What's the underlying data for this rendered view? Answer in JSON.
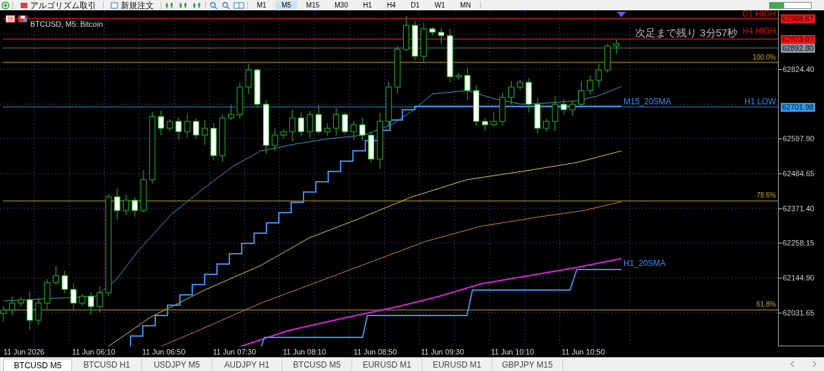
{
  "toolbar": {
    "buttons": [
      {
        "label": "アルゴリズム取引",
        "kind": "algo"
      },
      {
        "label": "新規注文",
        "kind": "order"
      }
    ],
    "timeframes": [
      {
        "label": "M1",
        "selected": false
      },
      {
        "label": "M5",
        "selected": true
      },
      {
        "label": "M15",
        "selected": false
      },
      {
        "label": "M30",
        "selected": false
      },
      {
        "label": "H1",
        "selected": false
      },
      {
        "label": "H4",
        "selected": false
      },
      {
        "label": "D1",
        "selected": false
      },
      {
        "label": "W1",
        "selected": false
      },
      {
        "label": "MN",
        "selected": false
      }
    ]
  },
  "chart": {
    "title": "BTCUSD, M5: Bitcoin",
    "countdown": "次足まで残り 3分57秒",
    "levels": [
      {
        "kind": "high",
        "label": "D1 HIGH",
        "tag": "62988.67"
      },
      {
        "kind": "high",
        "label": "H4 HIGH",
        "tag": "62923.07"
      },
      {
        "kind": "bid",
        "tag": "62892.80"
      },
      {
        "kind": "fib",
        "label": "100.0%"
      },
      {
        "kind": "low",
        "label": "H1 LOW",
        "tag": "62701.98"
      },
      {
        "kind": "fib",
        "label": "78.6%"
      },
      {
        "kind": "fib",
        "label": "61.8%"
      }
    ],
    "line_labels": [
      "M15_20SMA",
      "H1_20SMA"
    ],
    "price_axis": [
      "62824.40",
      "62597.90",
      "62484.65",
      "62371.40",
      "62258.15",
      "62144.90",
      "62031.65"
    ],
    "time_axis": [
      "11 Jun 2026",
      "11 Jun 06:10",
      "11 Jun 06:50",
      "11 Jun 07:30",
      "11 Jun 08:10",
      "11 Jun 08:50",
      "11 Jun 09:30",
      "11 Jun 10:10",
      "11 Jun 10:50"
    ]
  },
  "tabs": [
    {
      "label": "BTCUSD M5",
      "selected": true
    },
    {
      "label": "BTCUSD H1",
      "selected": false
    },
    {
      "label": "USDJPY M5",
      "selected": false
    },
    {
      "label": "AUDJPY H1",
      "selected": false
    },
    {
      "label": "BTCUSD M5",
      "selected": false
    },
    {
      "label": "EURUSD M1",
      "selected": false
    },
    {
      "label": "EURUSD M1",
      "selected": false
    },
    {
      "label": "GBPJPY M15",
      "selected": false
    }
  ]
}
